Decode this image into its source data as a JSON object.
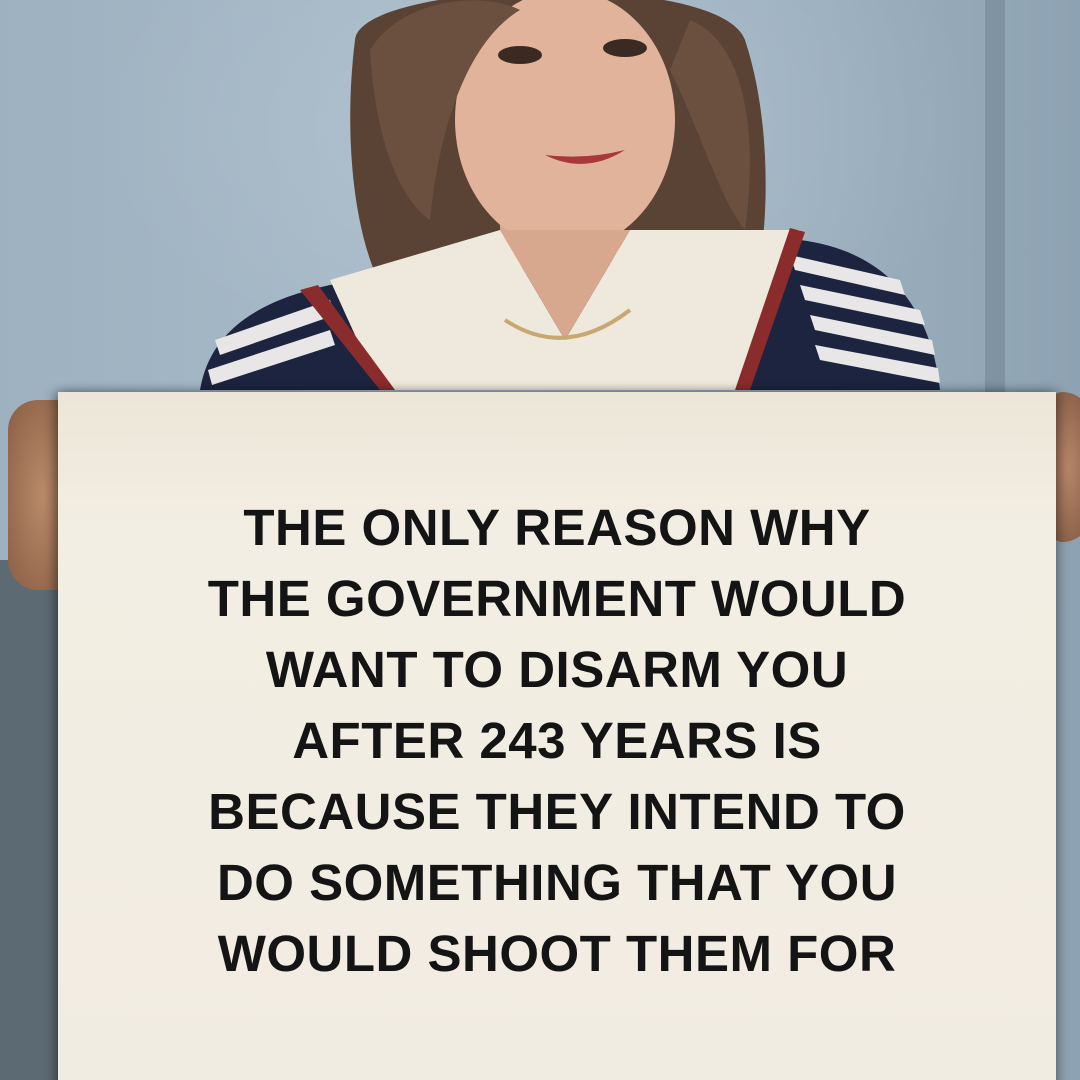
{
  "sign": {
    "lines": [
      "THE ONLY REASON WHY",
      "THE GOVERNMENT WOULD",
      "WANT TO DISARM YOU",
      "AFTER 243 YEARS IS",
      "BECAUSE THEY INTEND TO",
      "DO SOMETHING THAT YOU",
      "WOULD SHOOT THEM FOR"
    ]
  },
  "colors": {
    "wall": "#a7bac8",
    "sign": "#f1ece1",
    "text": "#141414",
    "shirt_stripe": "#1c2440",
    "collar": "#efe8dc"
  }
}
